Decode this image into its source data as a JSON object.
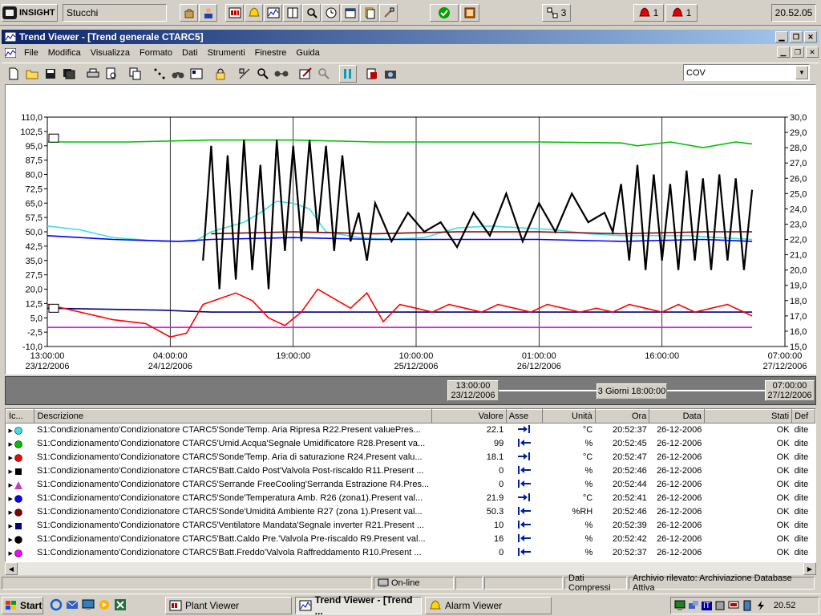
{
  "appbar": {
    "logo_text": "INSIGHT",
    "user": "Stucchi",
    "node_count": "3",
    "alarm_count_1": "1",
    "alarm_count_2": "1",
    "clock": "20.52.05"
  },
  "window": {
    "title": "Trend Viewer - [Trend generale CTARC5]"
  },
  "menu": [
    "File",
    "Modifica",
    "Visualizza",
    "Formato",
    "Dati",
    "Strumenti",
    "Finestre",
    "Guida"
  ],
  "toolbar": {
    "cov_value": "COV"
  },
  "chart_data": {
    "type": "line",
    "title": "",
    "x_ticks": [
      {
        "time": "13:00:00",
        "date": "23/12/2006"
      },
      {
        "time": "04:00:00",
        "date": "24/12/2006"
      },
      {
        "time": "19:00:00",
        "date": ""
      },
      {
        "time": "10:00:00",
        "date": "25/12/2006"
      },
      {
        "time": "01:00:00",
        "date": "26/12/2006"
      },
      {
        "time": "16:00:00",
        "date": ""
      },
      {
        "time": "07:00:00",
        "date": "27/12/2006"
      }
    ],
    "y_left_ticks": [
      "110,0",
      "102,5",
      "95,0",
      "87,5",
      "80,0",
      "72,5",
      "65,0",
      "57,5",
      "50,0",
      "42,5",
      "35,0",
      "27,5",
      "20,0",
      "12,5",
      "5,0",
      "-2,5",
      "-10,0"
    ],
    "y_right_ticks": [
      "30,0",
      "29,0",
      "28,0",
      "27,0",
      "26,0",
      "25,0",
      "24,0",
      "23,0",
      "22,0",
      "21,0",
      "20,0",
      "19,0",
      "18,0",
      "17,0",
      "16,0",
      "15,0"
    ],
    "y_left_range": [
      -10,
      110
    ],
    "y_right_range": [
      15,
      30
    ],
    "x_range_hours": [
      0,
      90
    ],
    "grid": true,
    "series": [
      {
        "color": "#00c000",
        "axis": "left",
        "points": [
          [
            0,
            97
          ],
          [
            10,
            97
          ],
          [
            20,
            98
          ],
          [
            30,
            98
          ],
          [
            40,
            97
          ],
          [
            50,
            97
          ],
          [
            60,
            97
          ],
          [
            70,
            96.5
          ],
          [
            72,
            95
          ],
          [
            76,
            97
          ],
          [
            80,
            94
          ],
          [
            84,
            97
          ],
          [
            86,
            96
          ]
        ]
      },
      {
        "color": "#40e0e0",
        "axis": "left",
        "points": [
          [
            0,
            53
          ],
          [
            4,
            51
          ],
          [
            8,
            47
          ],
          [
            14,
            45
          ],
          [
            18,
            45
          ],
          [
            20,
            50
          ],
          [
            24,
            55
          ],
          [
            26,
            60
          ],
          [
            28,
            66
          ],
          [
            30,
            65
          ],
          [
            32,
            62
          ],
          [
            34,
            50
          ],
          [
            38,
            47
          ],
          [
            42,
            46
          ],
          [
            46,
            47
          ],
          [
            50,
            52
          ],
          [
            54,
            53
          ],
          [
            58,
            52
          ],
          [
            62,
            51
          ],
          [
            66,
            49
          ],
          [
            70,
            48
          ],
          [
            74,
            48
          ],
          [
            78,
            48
          ],
          [
            82,
            47
          ],
          [
            86,
            46
          ]
        ]
      },
      {
        "color": "#800000",
        "axis": "left",
        "points": [
          [
            20,
            49
          ],
          [
            30,
            50
          ],
          [
            40,
            49
          ],
          [
            50,
            50
          ],
          [
            60,
            50
          ],
          [
            70,
            49
          ],
          [
            80,
            50
          ],
          [
            86,
            50
          ]
        ]
      },
      {
        "color": "#0000ff",
        "axis": "left",
        "points": [
          [
            0,
            48
          ],
          [
            8,
            46
          ],
          [
            16,
            45
          ],
          [
            20,
            46
          ],
          [
            30,
            47
          ],
          [
            40,
            46
          ],
          [
            50,
            46
          ],
          [
            60,
            46
          ],
          [
            70,
            45
          ],
          [
            80,
            46
          ],
          [
            86,
            45
          ]
        ]
      },
      {
        "color": "#000080",
        "axis": "left",
        "points": [
          [
            0,
            10
          ],
          [
            14,
            9
          ],
          [
            20,
            8
          ],
          [
            30,
            8
          ],
          [
            40,
            8
          ],
          [
            50,
            8
          ],
          [
            60,
            8
          ],
          [
            70,
            8
          ],
          [
            80,
            8
          ],
          [
            86,
            8
          ]
        ]
      },
      {
        "color": "#ff00ff",
        "axis": "left",
        "points": [
          [
            0,
            0
          ],
          [
            20,
            0
          ],
          [
            40,
            0
          ],
          [
            60,
            0
          ],
          [
            80,
            0
          ],
          [
            86,
            0
          ]
        ]
      },
      {
        "color": "#ff0000",
        "axis": "left",
        "points": [
          [
            0,
            12
          ],
          [
            4,
            8
          ],
          [
            8,
            4
          ],
          [
            12,
            2
          ],
          [
            15,
            -5
          ],
          [
            17,
            -3
          ],
          [
            19,
            12
          ],
          [
            21,
            15
          ],
          [
            23,
            18
          ],
          [
            25,
            14
          ],
          [
            27,
            5
          ],
          [
            29,
            1
          ],
          [
            31,
            8
          ],
          [
            33,
            20
          ],
          [
            35,
            15
          ],
          [
            37,
            10
          ],
          [
            39,
            18
          ],
          [
            41,
            3
          ],
          [
            43,
            12
          ],
          [
            45,
            10
          ],
          [
            47,
            8
          ],
          [
            49,
            12
          ],
          [
            51,
            10
          ],
          [
            53,
            8
          ],
          [
            55,
            12
          ],
          [
            57,
            10
          ],
          [
            59,
            8
          ],
          [
            61,
            12
          ],
          [
            63,
            10
          ],
          [
            65,
            8
          ],
          [
            67,
            10
          ],
          [
            69,
            8
          ],
          [
            71,
            12
          ],
          [
            73,
            10
          ],
          [
            75,
            8
          ],
          [
            77,
            12
          ],
          [
            79,
            8
          ],
          [
            81,
            10
          ],
          [
            83,
            12
          ],
          [
            85,
            8
          ],
          [
            86,
            6
          ]
        ]
      },
      {
        "color": "#000000",
        "axis": "left",
        "points": [
          [
            19,
            35
          ],
          [
            20,
            95
          ],
          [
            21,
            20
          ],
          [
            22,
            90
          ],
          [
            23,
            25
          ],
          [
            24,
            98
          ],
          [
            25,
            30
          ],
          [
            26,
            85
          ],
          [
            27,
            20
          ],
          [
            28,
            98
          ],
          [
            29,
            40
          ],
          [
            30,
            95
          ],
          [
            31,
            45
          ],
          [
            32,
            98
          ],
          [
            33,
            50
          ],
          [
            34,
            95
          ],
          [
            35,
            40
          ],
          [
            36,
            90
          ],
          [
            37,
            45
          ],
          [
            38,
            60
          ],
          [
            39,
            35
          ],
          [
            40,
            65
          ],
          [
            42,
            45
          ],
          [
            44,
            60
          ],
          [
            46,
            50
          ],
          [
            48,
            55
          ],
          [
            50,
            42
          ],
          [
            52,
            60
          ],
          [
            54,
            48
          ],
          [
            56,
            70
          ],
          [
            58,
            45
          ],
          [
            60,
            65
          ],
          [
            62,
            50
          ],
          [
            64,
            70
          ],
          [
            66,
            55
          ],
          [
            68,
            60
          ],
          [
            69,
            50
          ],
          [
            70,
            75
          ],
          [
            71,
            35
          ],
          [
            72,
            85
          ],
          [
            73,
            30
          ],
          [
            74,
            80
          ],
          [
            75,
            35
          ],
          [
            76,
            75
          ],
          [
            77,
            30
          ],
          [
            78,
            82
          ],
          [
            79,
            35
          ],
          [
            80,
            78
          ],
          [
            81,
            30
          ],
          [
            82,
            80
          ],
          [
            83,
            35
          ],
          [
            84,
            78
          ],
          [
            85,
            30
          ],
          [
            86,
            72
          ]
        ]
      }
    ]
  },
  "range": {
    "start_time": "13:00:00",
    "start_date": "23/12/2006",
    "span": "3 Giorni 18:00:00",
    "end_time": "07:00:00",
    "end_date": "27/12/2006"
  },
  "table": {
    "headers": [
      "Ic...",
      "Descrizione",
      "Valore",
      "Asse",
      "Unità",
      "Ora",
      "Data",
      "Stati",
      "Def"
    ],
    "rows": [
      {
        "marker": "circle",
        "color": "#40e0e0",
        "desc": "S1:Condizionamento'Condizionatore CTARC5'Sonde'Temp. Aria Ripresa R22.Present valuePres...",
        "value": "22.1",
        "axis": "right",
        "unit": "°C",
        "time": "20:52:37",
        "date": "26-12-2006",
        "state": "OK",
        "def": "dite"
      },
      {
        "marker": "circle",
        "color": "#00c000",
        "desc": "S1:Condizionamento'Condizionatore CTARC5'Umid.Acqua'Segnale Umidificatore R28.Present va...",
        "value": "99",
        "axis": "left",
        "unit": "%",
        "time": "20:52:45",
        "date": "26-12-2006",
        "state": "OK",
        "def": "dite"
      },
      {
        "marker": "circle",
        "color": "#ff0000",
        "desc": "S1:Condizionamento'Condizionatore CTARC5'Sonde'Temp. Aria di saturazione  R24.Present valu...",
        "value": "18.1",
        "axis": "right",
        "unit": "°C",
        "time": "20:52:47",
        "date": "26-12-2006",
        "state": "OK",
        "def": "dite"
      },
      {
        "marker": "square",
        "color": "#000000",
        "desc": "S1:Condizionamento'Condizionatore CTARC5'Batt.Caldo Post'Valvola Post-riscaldo R11.Present ...",
        "value": "0",
        "axis": "left",
        "unit": "%",
        "time": "20:52:46",
        "date": "26-12-2006",
        "state": "OK",
        "def": "dite"
      },
      {
        "marker": "triangle",
        "color": "#c040c0",
        "desc": "S1:Condizionamento'Condizionatore CTARC5'Serrande FreeCooling'Serranda Estrazione R4.Pres...",
        "value": "0",
        "axis": "left",
        "unit": "%",
        "time": "20:52:44",
        "date": "26-12-2006",
        "state": "OK",
        "def": "dite"
      },
      {
        "marker": "circle",
        "color": "#0000ff",
        "desc": "S1:Condizionamento'Condizionatore CTARC5'Sonde'Temperatura Amb. R26 (zona1).Present val...",
        "value": "21.9",
        "axis": "right",
        "unit": "°C",
        "time": "20:52:41",
        "date": "26-12-2006",
        "state": "OK",
        "def": "dite"
      },
      {
        "marker": "circle",
        "color": "#800000",
        "desc": "S1:Condizionamento'Condizionatore CTARC5'Sonde'Umidità Ambiente R27 (zona 1).Present val...",
        "value": "50.3",
        "axis": "left",
        "unit": "%RH",
        "time": "20:52:46",
        "date": "26-12-2006",
        "state": "OK",
        "def": "dite"
      },
      {
        "marker": "square",
        "color": "#000080",
        "desc": "S1:Condizionamento'Condizionatore CTARC5'Ventilatore Mandata'Segnale inverter R21.Present ...",
        "value": "10",
        "axis": "left",
        "unit": "%",
        "time": "20:52:39",
        "date": "26-12-2006",
        "state": "OK",
        "def": "dite"
      },
      {
        "marker": "circle",
        "color": "#000000",
        "desc": "S1:Condizionamento'Condizionatore CTARC5'Batt.Caldo Pre.'Valvola Pre-riscaldo R9.Present val...",
        "value": "16",
        "axis": "left",
        "unit": "%",
        "time": "20:52:42",
        "date": "26-12-2006",
        "state": "OK",
        "def": "dite"
      },
      {
        "marker": "circle",
        "color": "#ff00ff",
        "desc": "S1:Condizionamento'Condizionatore CTARC5'Batt.Freddo'Valvola Raffreddamento R10.Present ...",
        "value": "0",
        "axis": "left",
        "unit": "%",
        "time": "20:52:37",
        "date": "26-12-2006",
        "state": "OK",
        "def": "dite"
      }
    ]
  },
  "status": {
    "online": "On-line",
    "compressed": "Dati Compressi",
    "archive": "Archivio rilevato: Archiviazione Database Attiva"
  },
  "taskbar": {
    "start": "Start",
    "tasks": [
      "Plant Viewer",
      "Trend Viewer - [Trend ...",
      "Alarm Viewer"
    ],
    "lang": "IT",
    "time": "20.52"
  }
}
